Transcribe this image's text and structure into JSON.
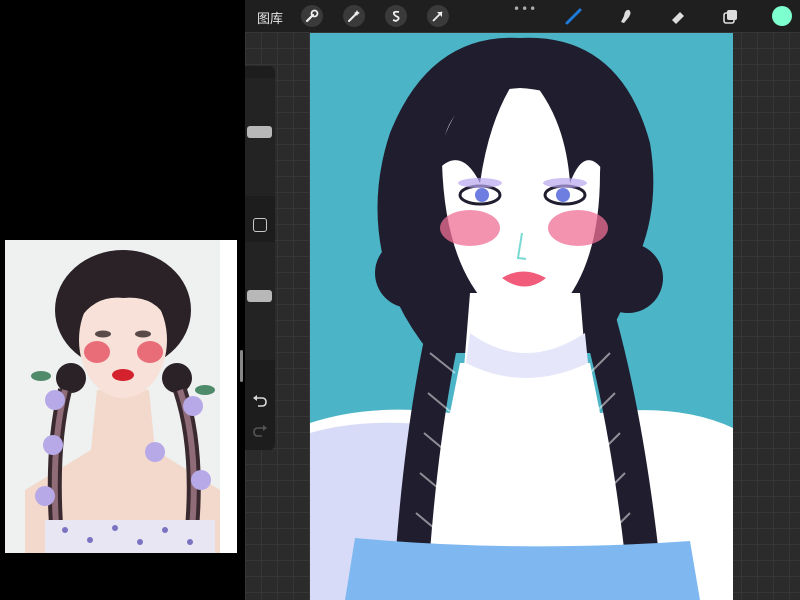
{
  "topbar": {
    "gallery_label": "图库",
    "tools_left": [
      "wrench-icon",
      "magic-wand-icon",
      "selection-s-icon",
      "transform-arrow-icon"
    ],
    "tools_right": [
      "brush-icon",
      "smudge-icon",
      "eraser-icon",
      "layers-icon"
    ],
    "active_tool": "brush-icon",
    "accent_color": "#1e7bd9",
    "current_color": "#7effd0"
  },
  "sidebar": {
    "brush_size_level": 0.55,
    "opacity_level": 0.55,
    "modify_button": "square-icon",
    "undo": "undo-icon",
    "redo": "redo-icon"
  },
  "canvas": {
    "background_color": "#4bb4c6",
    "subject": "illustration-portrait"
  },
  "reference": {
    "subject": "reference-photo"
  }
}
